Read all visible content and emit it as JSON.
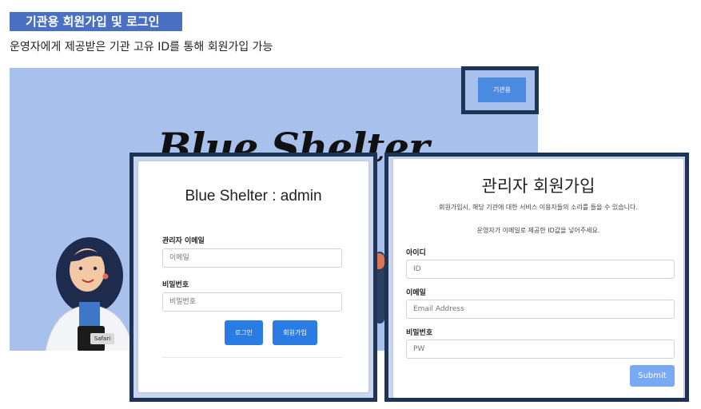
{
  "header": {
    "title": "기관용 회원가입 및 로그인",
    "subtitle": "운영자에게 제공받은 기관 고유 ID를 통해 회원가입 가능"
  },
  "hero": {
    "brand_title": "Blue Shelter",
    "org_button": "기관용",
    "safari_label": "Safari"
  },
  "login": {
    "title": "Blue Shelter : admin",
    "email_label": "관리자 이메일",
    "email_placeholder": "이메일",
    "password_label": "비밀번호",
    "password_placeholder": "비밀번호",
    "login_button": "로그인",
    "signup_button": "회원가입"
  },
  "signup": {
    "title": "관리자 회원가입",
    "desc1": "회원가입시, 해당 기관에 대한 서비스 이용자들의 소리를 들을 수 있습니다.",
    "desc2": "운영자가 이메일로 제공한 ID값을 넣어주세요.",
    "id_label": "아이디",
    "id_placeholder": "ID",
    "email_label": "이메일",
    "email_placeholder": "Email Address",
    "password_label": "비밀번호",
    "password_placeholder": "PW",
    "submit_button": "Submit"
  },
  "colors": {
    "accent": "#4a70c3",
    "hero_bg": "#a7c1ec",
    "frame": "#1c3556",
    "primary_button": "#2a7be4",
    "submit_button": "#7aa9f3"
  }
}
